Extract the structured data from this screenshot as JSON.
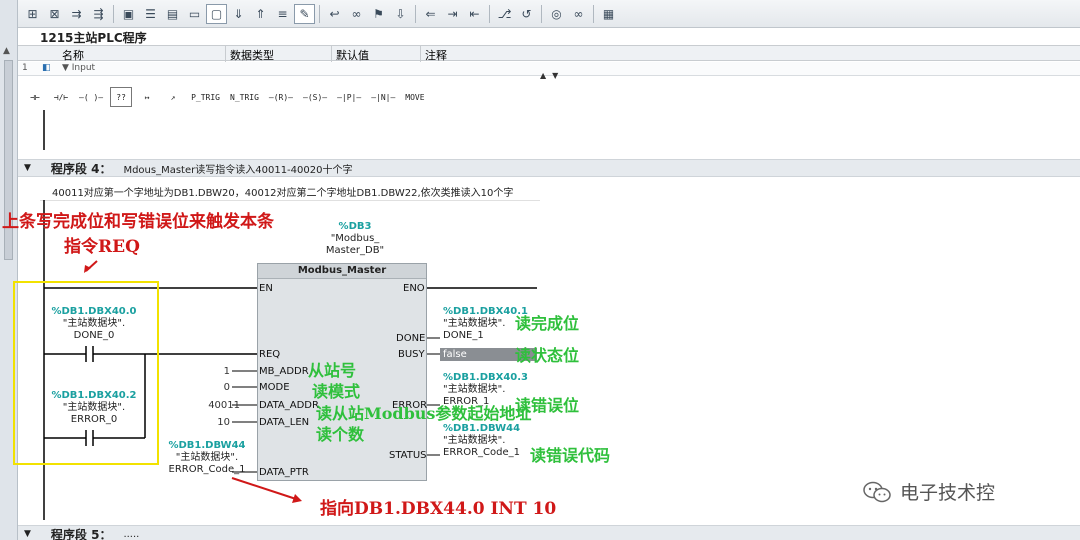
{
  "block_title": "1215主站PLC程序",
  "interface": {
    "columns": [
      "名称",
      "数据类型",
      "默认值",
      "注释"
    ],
    "row_index": "1",
    "row_label": "▼ Input"
  },
  "ladder_toolbar": [
    "⊣⊢",
    "⊣/⊢",
    "–( )–",
    "??",
    "↦",
    "↗",
    "P_TRIG",
    "N_TRIG",
    "–(R)–",
    "–(S)–",
    "–|P|–",
    "–|N|–",
    "MOVE"
  ],
  "segment4": {
    "label": "程序段 4：",
    "title": "Mdous_Master读写指令读入40011-40020十个字",
    "comment": "40011对应第一个字地址为DB1.DBW20，40012对应第二个字地址DB1.DBW22,依次类推读入10个字"
  },
  "segment5": {
    "label": "程序段 5：",
    "title": "....."
  },
  "fb": {
    "db_addr": "%DB3",
    "db_name": "\"Modbus_ Master_DB\"",
    "name": "Modbus_Master",
    "pins_left": [
      "EN",
      "REQ",
      "MB_ADDR",
      "MODE",
      "DATA_ADDR",
      "DATA_LEN",
      "DATA_PTR"
    ],
    "pins_right": [
      "ENO",
      "DONE",
      "BUSY",
      "ERROR",
      "STATUS"
    ],
    "params": {
      "mb_addr": "1",
      "mode": "0",
      "data_addr": "40011",
      "data_len": "10"
    },
    "busy_value": "false"
  },
  "operands": {
    "done0": {
      "addr": "%DB1.DBX40.0",
      "sym": "\"主站数据块\".",
      "tag": "DONE_0"
    },
    "error0": {
      "addr": "%DB1.DBX40.2",
      "sym": "\"主站数据块\".",
      "tag": "ERROR_0"
    },
    "data_ptr": {
      "addr": "%DB1.DBW44",
      "sym": "\"主站数据块\".",
      "tag": "ERROR_Code_1"
    },
    "done1": {
      "addr": "%DB1.DBX40.1",
      "sym": "\"主站数据块\".",
      "tag": "DONE_1"
    },
    "error1": {
      "addr": "%DB1.DBX40.3",
      "sym": "\"主站数据块\".",
      "tag": "ERROR_1"
    },
    "status1": {
      "addr": "%DB1.DBW44",
      "sym": "\"主站数据块\".",
      "tag": "ERROR_Code_1"
    }
  },
  "annotations": {
    "trigger": "上条写完成位和写错误位来触发本条",
    "req": "指令REQ",
    "slave": "从站号",
    "mode": "读模式",
    "data_addr": "读从站Modbus参数起始地址",
    "data_len": "读个数",
    "pointer": "指向DB1.DBX44.0 INT 10",
    "done": "读完成位",
    "busy": "读状态位",
    "error": "读错误位",
    "status": "读错误代码"
  },
  "watermark": "电子技术控",
  "colors": {
    "red": "#d01818",
    "green": "#2fc03c",
    "teal": "#1aa0a0",
    "wire": "#000000",
    "highlight": "#f2e200"
  }
}
